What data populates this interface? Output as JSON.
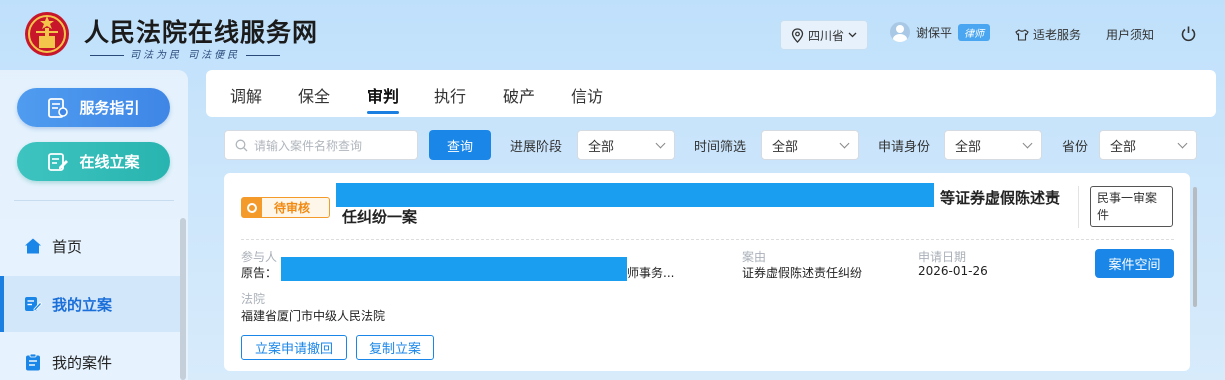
{
  "header": {
    "title": "人民法院在线服务网",
    "subtitle": "司法为民  司法便民",
    "region": "四川省",
    "user_name": "谢保平",
    "user_badge": "律师",
    "elder_service": "适老服务",
    "user_notice": "用户须知"
  },
  "sidebar": {
    "guide_button": "服务指引",
    "filing_button": "在线立案",
    "items": [
      {
        "label": "首页",
        "icon": "home-icon"
      },
      {
        "label": "我的立案",
        "icon": "edit-icon",
        "active": true
      },
      {
        "label": "我的案件",
        "icon": "clipboard-icon"
      }
    ]
  },
  "tabs": [
    "调解",
    "保全",
    "审判",
    "执行",
    "破产",
    "信访"
  ],
  "active_tab": "审判",
  "filters": {
    "search_placeholder": "请输入案件名称查询",
    "search_button": "查询",
    "progress_label": "进展阶段",
    "progress_value": "全部",
    "time_label": "时间筛选",
    "time_value": "全部",
    "identity_label": "申请身份",
    "identity_value": "全部",
    "province_label": "省份",
    "province_value": "全部"
  },
  "case": {
    "status": "待审核",
    "title_suffix": "等证券虚假陈述责",
    "title_line2": "任纠纷一案",
    "case_type": "民事一审案件",
    "participants_label": "参与人",
    "plaintiff_prefix": "原告：",
    "plaintiff_suffix": "师事务...",
    "cause_label": "案由",
    "cause_value": "证券虚假陈述责任纠纷",
    "date_label": "申请日期",
    "date_value": "2026-01-26",
    "court_label": "法院",
    "court_value": "福建省厦门市中级人民法院",
    "space_button": "案件空间",
    "withdraw_button": "立案申请撤回",
    "copy_button": "复制立案"
  },
  "colors": {
    "primary": "#1a86e8",
    "teal": "#28b4b0",
    "status_orange": "#f39a2a",
    "redaction": "#1a9ef0"
  }
}
